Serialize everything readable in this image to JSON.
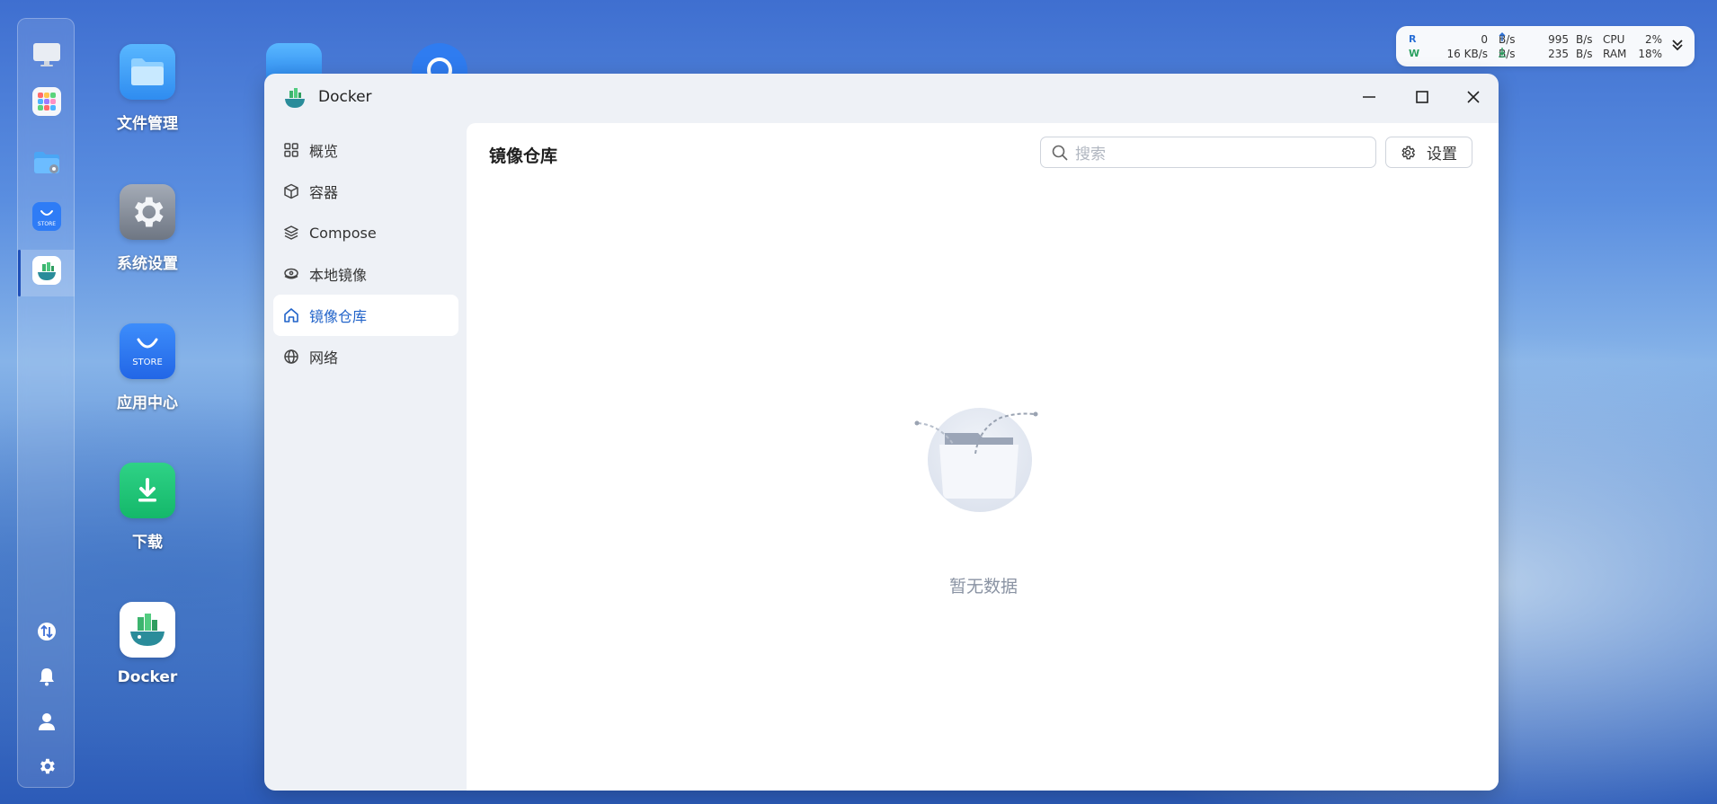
{
  "dock": {
    "items": [
      {
        "name": "dock-monitor-icon"
      },
      {
        "name": "dock-apps-grid-icon"
      },
      {
        "name": "dock-file-settings-icon"
      },
      {
        "name": "dock-store-icon"
      },
      {
        "name": "dock-docker-icon"
      }
    ],
    "bottom": [
      "transfer-icon",
      "bell-icon",
      "user-icon",
      "gear-icon"
    ],
    "store_label": "STORE"
  },
  "desktop": {
    "icons": [
      {
        "label": "文件管理",
        "icon": "folder-icon"
      },
      {
        "label": "系统设置",
        "icon": "settings-gear-icon"
      },
      {
        "label": "应用中心",
        "icon": "store-bag-icon",
        "badge": "STORE"
      },
      {
        "label": "下载",
        "icon": "download-icon"
      },
      {
        "label": "Docker",
        "icon": "docker-whale-icon"
      }
    ]
  },
  "status": {
    "r_label": "R",
    "w_label": "W",
    "r_value": "0",
    "r_unit": "B/s",
    "w_value": "16 KB/s",
    "up_value": "995",
    "up_unit": "B/s",
    "down_value": "235",
    "down_unit": "B/s",
    "cpu_label": "CPU",
    "cpu_value": "2%",
    "ram_label": "RAM",
    "ram_value": "18%"
  },
  "window": {
    "title": "Docker",
    "nav": [
      {
        "label": "概览",
        "icon": "grid-icon",
        "active": false
      },
      {
        "label": "容器",
        "icon": "cube-icon",
        "active": false
      },
      {
        "label": "Compose",
        "icon": "layers-icon",
        "active": false
      },
      {
        "label": "本地镜像",
        "icon": "disk-icon",
        "active": false
      },
      {
        "label": "镜像仓库",
        "icon": "house-icon",
        "active": true
      },
      {
        "label": "网络",
        "icon": "globe-icon",
        "active": false
      }
    ],
    "page_title": "镜像仓库",
    "search_placeholder": "搜索",
    "settings_label": "设置",
    "empty_text": "暂无数据"
  },
  "colors": {
    "accent": "#2163c9",
    "window_bg": "#eef1f6",
    "muted_text": "#8a93a3"
  }
}
